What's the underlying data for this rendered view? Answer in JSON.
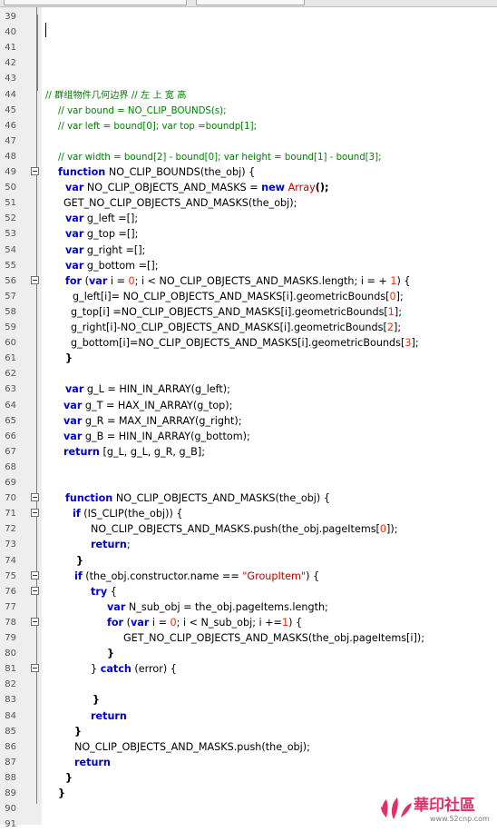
{
  "editor": {
    "line_start": 39,
    "lines": [
      {
        "n": "39",
        "fold": false,
        "indent": 0,
        "tokens": []
      },
      {
        "n": "40",
        "fold": false,
        "indent": 0,
        "tokens": []
      },
      {
        "n": "41",
        "fold": false,
        "indent": 0,
        "tokens": []
      },
      {
        "n": "42",
        "fold": false,
        "indent": 0,
        "tokens": []
      },
      {
        "n": "43",
        "fold": false,
        "indent": 0,
        "tokens": []
      },
      {
        "n": "44",
        "fold": false,
        "indent": 50,
        "tokens": [
          {
            "t": "// 群组物件几何边界 // 左 上 宽 高",
            "c": "cmt"
          }
        ]
      },
      {
        "n": "45",
        "fold": false,
        "indent": 64,
        "tokens": [
          {
            "t": "// var bound = NO_CLIP_BOUNDS(s);",
            "c": "cmt"
          }
        ]
      },
      {
        "n": "46",
        "fold": false,
        "indent": 64,
        "tokens": [
          {
            "t": "// var left = bound[0]; var top =boundp[1];",
            "c": "cmt"
          }
        ]
      },
      {
        "n": "47",
        "fold": false,
        "indent": 0,
        "tokens": []
      },
      {
        "n": "48",
        "fold": false,
        "indent": 64,
        "tokens": [
          {
            "t": "// var width = bound[2] - bound[0]; var height = bound[1] - bound[3];",
            "c": "cmt"
          }
        ]
      },
      {
        "n": "49",
        "fold": true,
        "indent": 64,
        "tokens": [
          {
            "t": "function",
            "c": "kw"
          },
          {
            "t": " NO_CLIP_BOUNDS(the_obj) {",
            "c": "idn"
          }
        ]
      },
      {
        "n": "50",
        "fold": false,
        "indent": 72,
        "tokens": [
          {
            "t": "var",
            "c": "kw"
          },
          {
            "t": " NO_CLIP_OBJECTS_AND_MASKS = ",
            "c": "idn"
          },
          {
            "t": "new",
            "c": "kw"
          },
          {
            "t": " ",
            "c": "idn"
          },
          {
            "t": "Array",
            "c": "typ"
          },
          {
            "t": "();",
            "c": "pun"
          }
        ]
      },
      {
        "n": "51",
        "fold": false,
        "indent": 70,
        "tokens": [
          {
            "t": "GET_NO_CLIP_OBJECTS_AND_MASKS(the_obj);",
            "c": "idn"
          }
        ]
      },
      {
        "n": "52",
        "fold": false,
        "indent": 72,
        "tokens": [
          {
            "t": "var",
            "c": "kw"
          },
          {
            "t": " g_left =[];",
            "c": "idn"
          }
        ]
      },
      {
        "n": "53",
        "fold": false,
        "indent": 72,
        "tokens": [
          {
            "t": "var",
            "c": "kw"
          },
          {
            "t": " g_top =[];",
            "c": "idn"
          }
        ]
      },
      {
        "n": "54",
        "fold": false,
        "indent": 72,
        "tokens": [
          {
            "t": "var",
            "c": "kw"
          },
          {
            "t": " g_right =[];",
            "c": "idn"
          }
        ]
      },
      {
        "n": "55",
        "fold": false,
        "indent": 72,
        "tokens": [
          {
            "t": "var",
            "c": "kw"
          },
          {
            "t": " g_bottom =[];",
            "c": "idn"
          }
        ]
      },
      {
        "n": "56",
        "fold": true,
        "indent": 72,
        "tokens": [
          {
            "t": "for",
            "c": "kw"
          },
          {
            "t": " (",
            "c": "idn"
          },
          {
            "t": "var",
            "c": "kw"
          },
          {
            "t": " i = ",
            "c": "idn"
          },
          {
            "t": "0",
            "c": "num"
          },
          {
            "t": "; i < NO_CLIP_OBJECTS_AND_MASKS.length; i = + ",
            "c": "idn"
          },
          {
            "t": "1",
            "c": "num"
          },
          {
            "t": ") {",
            "c": "idn"
          }
        ]
      },
      {
        "n": "57",
        "fold": false,
        "indent": 80,
        "tokens": [
          {
            "t": "g_left[i]= NO_CLIP_OBJECTS_AND_MASKS[i].geometricBounds[",
            "c": "idn"
          },
          {
            "t": "0",
            "c": "num"
          },
          {
            "t": "];",
            "c": "idn"
          }
        ]
      },
      {
        "n": "58",
        "fold": false,
        "indent": 78,
        "tokens": [
          {
            "t": "g_top[i] =NO_CLIP_OBJECTS_AND_MASKS[i].geometricBounds[",
            "c": "idn"
          },
          {
            "t": "1",
            "c": "num"
          },
          {
            "t": "];",
            "c": "idn"
          }
        ]
      },
      {
        "n": "59",
        "fold": false,
        "indent": 78,
        "tokens": [
          {
            "t": "g_right[i]-NO_CLIP_OBJECTS_AND_MASKS[i].geometricBounds[",
            "c": "idn"
          },
          {
            "t": "2",
            "c": "num"
          },
          {
            "t": "];",
            "c": "idn"
          }
        ]
      },
      {
        "n": "60",
        "fold": false,
        "indent": 78,
        "tokens": [
          {
            "t": "g_bottom[i]=NO_CLIP_OBJECTS_AND_MASKS[i].geometricBounds[",
            "c": "idn"
          },
          {
            "t": "3",
            "c": "num"
          },
          {
            "t": "];",
            "c": "idn"
          }
        ]
      },
      {
        "n": "61",
        "fold": false,
        "indent": 72,
        "tokens": [
          {
            "t": "}",
            "c": "pun"
          }
        ]
      },
      {
        "n": "62",
        "fold": false,
        "indent": 0,
        "tokens": []
      },
      {
        "n": "63",
        "fold": false,
        "indent": 72,
        "tokens": [
          {
            "t": "var",
            "c": "kw"
          },
          {
            "t": " g_L = HIN_IN_ARRAY(g_left);",
            "c": "idn"
          }
        ]
      },
      {
        "n": "64",
        "fold": false,
        "indent": 70,
        "tokens": [
          {
            "t": "var",
            "c": "kw"
          },
          {
            "t": " g_T = HAX_IN_ARRAY(g_top);",
            "c": "idn"
          }
        ]
      },
      {
        "n": "65",
        "fold": false,
        "indent": 70,
        "tokens": [
          {
            "t": "var",
            "c": "kw"
          },
          {
            "t": " g_R = MAX_IN_ARRAY(g_right);",
            "c": "idn"
          }
        ]
      },
      {
        "n": "66",
        "fold": false,
        "indent": 70,
        "tokens": [
          {
            "t": "var",
            "c": "kw"
          },
          {
            "t": " g_B = HIN_IN_ARRAY(g_bottom);",
            "c": "idn"
          }
        ]
      },
      {
        "n": "67",
        "fold": false,
        "indent": 70,
        "tokens": [
          {
            "t": "return",
            "c": "kw"
          },
          {
            "t": " [g_L, g_L, g_R, g_B];",
            "c": "idn"
          }
        ]
      },
      {
        "n": "68",
        "fold": false,
        "indent": 0,
        "tokens": []
      },
      {
        "n": "69",
        "fold": false,
        "indent": 0,
        "tokens": []
      },
      {
        "n": "70",
        "fold": true,
        "indent": 72,
        "tokens": [
          {
            "t": "function",
            "c": "kw"
          },
          {
            "t": " NO_CLIP_OBJECTS_AND_MASKS(the_obj) {",
            "c": "idn"
          }
        ]
      },
      {
        "n": "71",
        "fold": true,
        "indent": 80,
        "tokens": [
          {
            "t": "if",
            "c": "kw"
          },
          {
            "t": " (IS_CLIP(the_obj)) {",
            "c": "idn"
          }
        ]
      },
      {
        "n": "72",
        "fold": false,
        "indent": 100,
        "tokens": [
          {
            "t": "NO_CLIP_OBJECTS_AND_MASKS.push(the_obj.pageItems[",
            "c": "idn"
          },
          {
            "t": "0",
            "c": "num"
          },
          {
            "t": "]);",
            "c": "idn"
          }
        ]
      },
      {
        "n": "73",
        "fold": false,
        "indent": 100,
        "tokens": [
          {
            "t": "return",
            "c": "kw"
          },
          {
            "t": ";",
            "c": "idn"
          }
        ]
      },
      {
        "n": "74",
        "fold": false,
        "indent": 84,
        "tokens": [
          {
            "t": "}",
            "c": "pun"
          }
        ]
      },
      {
        "n": "75",
        "fold": true,
        "indent": 82,
        "tokens": [
          {
            "t": "if",
            "c": "kw"
          },
          {
            "t": " (the_obj.constructor.name == ",
            "c": "idn"
          },
          {
            "t": "\"GroupItem\"",
            "c": "str"
          },
          {
            "t": ") {",
            "c": "idn"
          }
        ]
      },
      {
        "n": "76",
        "fold": true,
        "indent": 100,
        "tokens": [
          {
            "t": "try",
            "c": "kw"
          },
          {
            "t": " {",
            "c": "idn"
          }
        ]
      },
      {
        "n": "77",
        "fold": false,
        "indent": 118,
        "tokens": [
          {
            "t": "var",
            "c": "kw"
          },
          {
            "t": " N_sub_obj = the_obj.pageItems.length;",
            "c": "idn"
          }
        ]
      },
      {
        "n": "78",
        "fold": true,
        "indent": 118,
        "tokens": [
          {
            "t": "for",
            "c": "kw"
          },
          {
            "t": " (",
            "c": "idn"
          },
          {
            "t": "var",
            "c": "kw"
          },
          {
            "t": " i = ",
            "c": "idn"
          },
          {
            "t": "0",
            "c": "num"
          },
          {
            "t": "; i < N_sub_obj; i +=",
            "c": "idn"
          },
          {
            "t": "1",
            "c": "num"
          },
          {
            "t": ") {",
            "c": "idn"
          }
        ]
      },
      {
        "n": "79",
        "fold": false,
        "indent": 136,
        "tokens": [
          {
            "t": "GET_NO_CLIP_OBJECTS_AND_MASKS(the_obj.pageItems[i]);",
            "c": "idn"
          }
        ]
      },
      {
        "n": "80",
        "fold": false,
        "indent": 118,
        "tokens": [
          {
            "t": "}",
            "c": "pun"
          }
        ]
      },
      {
        "n": "81",
        "fold": true,
        "indent": 100,
        "tokens": [
          {
            "t": "} ",
            "c": "idn"
          },
          {
            "t": "catch",
            "c": "kw"
          },
          {
            "t": " (error) {",
            "c": "idn"
          }
        ]
      },
      {
        "n": "82",
        "fold": false,
        "indent": 0,
        "tokens": []
      },
      {
        "n": "83",
        "fold": false,
        "indent": 102,
        "tokens": [
          {
            "t": "}",
            "c": "pun"
          }
        ]
      },
      {
        "n": "84",
        "fold": false,
        "indent": 100,
        "tokens": [
          {
            "t": "return",
            "c": "kw"
          }
        ]
      },
      {
        "n": "85",
        "fold": false,
        "indent": 82,
        "tokens": [
          {
            "t": "}",
            "c": "pun"
          }
        ]
      },
      {
        "n": "86",
        "fold": false,
        "indent": 82,
        "tokens": [
          {
            "t": "NO_CLIP_OBJECTS_AND_MASKS.push(the_obj);",
            "c": "idn"
          }
        ]
      },
      {
        "n": "87",
        "fold": false,
        "indent": 82,
        "tokens": [
          {
            "t": "return",
            "c": "kw"
          }
        ]
      },
      {
        "n": "88",
        "fold": false,
        "indent": 72,
        "tokens": [
          {
            "t": "}",
            "c": "pun"
          }
        ]
      },
      {
        "n": "89",
        "fold": false,
        "indent": 64,
        "tokens": [
          {
            "t": "}",
            "c": "pun"
          }
        ]
      },
      {
        "n": "90",
        "fold": false,
        "indent": 0,
        "tokens": []
      },
      {
        "n": "91",
        "fold": false,
        "indent": 0,
        "tokens": []
      }
    ]
  },
  "watermark": {
    "text": "華印社區",
    "url": "www.52cnp.com",
    "color": "#e0306a"
  }
}
